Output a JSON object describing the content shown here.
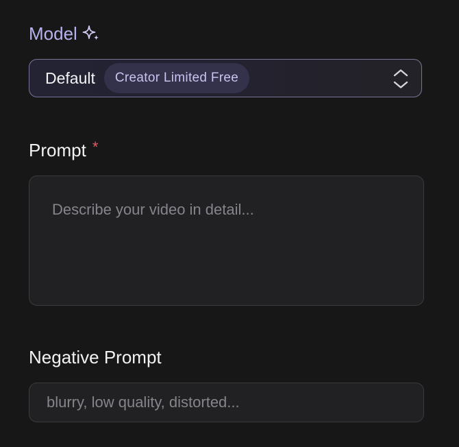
{
  "model": {
    "label": "Model",
    "label_icon": "sparkle-icon",
    "selected_value": "Default",
    "badge": "Creator Limited Free",
    "select_icon": "chevron-updown-icon"
  },
  "prompt": {
    "label": "Prompt",
    "required_marker": "*",
    "placeholder": "Describe your video in detail...",
    "value": ""
  },
  "negative_prompt": {
    "label": "Negative Prompt",
    "placeholder": "blurry, low quality, distorted...",
    "value": ""
  },
  "colors": {
    "background": "#171717",
    "accent_label": "#b7b2ee",
    "badge_bg": "#34324a",
    "badge_text": "#c9c3f0",
    "required": "#e05d64",
    "field_bg": "#212124",
    "field_border": "#3b3b3f",
    "placeholder": "#85858b"
  }
}
